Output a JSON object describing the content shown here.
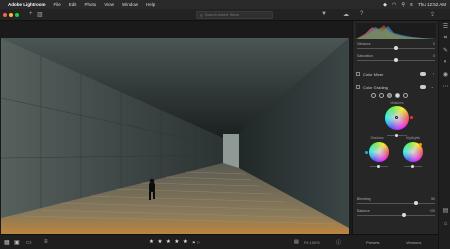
{
  "menubar": {
    "app_name": "Adobe Lightroom",
    "items": [
      "File",
      "Edit",
      "Photo",
      "View",
      "Window",
      "Help"
    ],
    "time": "Thu 12:52 AM"
  },
  "toolbar": {
    "search_placeholder": "Search Adobe Stock"
  },
  "panel": {
    "sliders_top": [
      {
        "label": "Vibrance",
        "value": "0",
        "level": 0.5
      },
      {
        "label": "Saturation",
        "value": "0",
        "level": 0.5
      }
    ],
    "color_mixer_label": "Color Mixer",
    "color_grading_label": "Color Grading",
    "midtones_label": "Midtones",
    "shadows_label": "Shadows",
    "highlights_label": "Highlights",
    "blending_label": "Blending",
    "blending_value": "50",
    "blending_level": 0.75,
    "balance_label": "Balance",
    "balance_value": "+20",
    "balance_level": 0.6
  },
  "bottombar": {
    "stars": "★ ★ ★ ★ ★",
    "zoom": "Fit  100%"
  },
  "panel_bottom": {
    "presets": "Presets",
    "versions": "Versions"
  },
  "colors": {
    "accent": "#4a90e2",
    "close": "#ff5f57",
    "minimize": "#febc2e",
    "zoom": "#28c840"
  }
}
